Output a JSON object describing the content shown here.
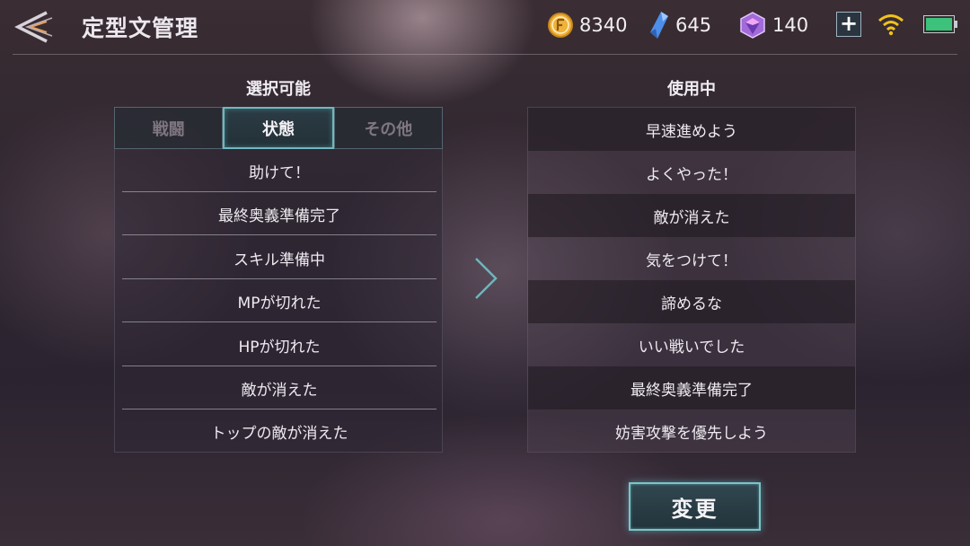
{
  "header": {
    "title": "定型文管理",
    "currencies": [
      {
        "icon": "gold-coin-icon",
        "value": "8340"
      },
      {
        "icon": "blue-crystal-icon",
        "value": "645"
      },
      {
        "icon": "purple-gem-icon",
        "value": "140"
      }
    ],
    "plus_label": "+"
  },
  "left_panel": {
    "title": "選択可能",
    "tabs": [
      {
        "label": "戦闘",
        "active": false
      },
      {
        "label": "状態",
        "active": true
      },
      {
        "label": "その他",
        "active": false
      }
    ],
    "items": [
      "助けて！",
      "最終奥義準備完了",
      "スキル準備中",
      "MPが切れた",
      "HPが切れた",
      "敵が消えた",
      "トップの敵が消えた"
    ]
  },
  "right_panel": {
    "title": "使用中",
    "items": [
      "早速進めよう",
      "よくやった！",
      "敵が消えた",
      "気をつけて！",
      "諦めるな",
      "いい戦いでした",
      "最終奥義準備完了",
      "妨害攻撃を優先しよう"
    ]
  },
  "change_button": {
    "label": "変更"
  },
  "colors": {
    "accent_teal": "#7cc4c8",
    "gold": "#f0b23a",
    "crystal_blue": "#4d8fe8",
    "gem_purple": "#a36ad9",
    "battery_green": "#3cc27a",
    "wifi_yellow": "#f2c21b"
  }
}
